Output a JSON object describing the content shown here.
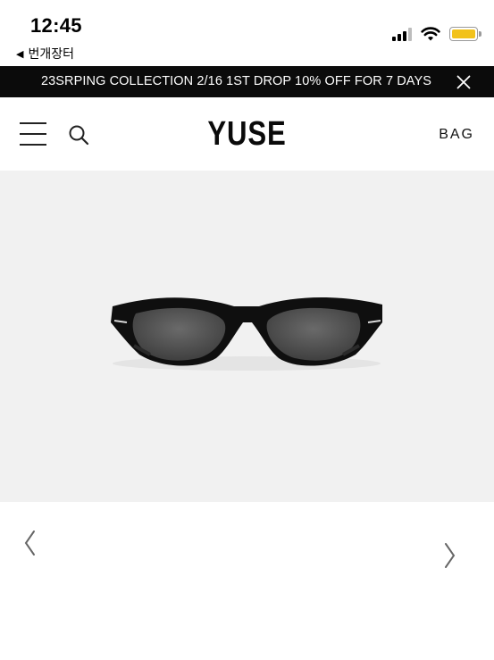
{
  "status_bar": {
    "time": "12:45",
    "back_app": "번개장터",
    "battery_color": "#f2c21b"
  },
  "promo_banner": {
    "text": "23SRPING COLLECTION 2/16 1ST DROP 10% OFF FOR 7 DAYS",
    "close_icon": "close-icon"
  },
  "header": {
    "logo": "YUSE",
    "bag_label": "BAG",
    "menu_icon": "hamburger-menu-icon",
    "search_icon": "search-icon"
  },
  "product": {
    "image_icon": "sunglasses-image",
    "background_color": "#f1f1f1"
  },
  "carousel": {
    "prev_icon": "chevron-left-icon",
    "next_icon": "chevron-right-icon"
  }
}
